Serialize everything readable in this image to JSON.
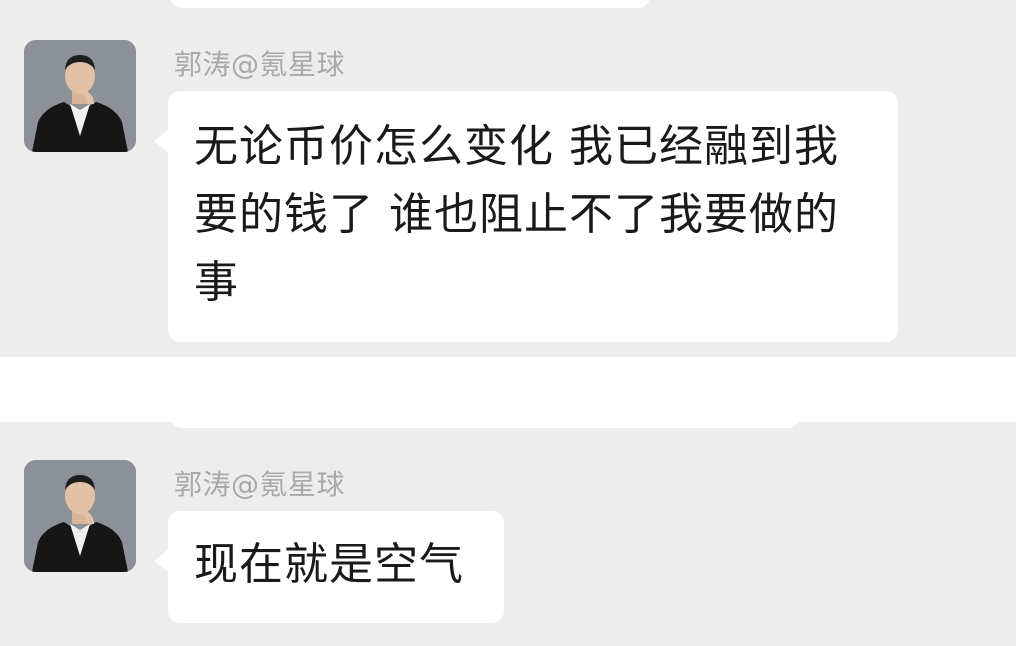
{
  "messages": [
    {
      "sender": "郭涛@氪星球",
      "avatar_icon": "user-avatar-portrait",
      "lines": [
        "无论币价怎么变化 我已经融到我",
        "要的钱了 谁也阻止不了我要做的",
        "事"
      ]
    },
    {
      "sender": "郭涛@氪星球",
      "avatar_icon": "user-avatar-portrait",
      "lines": [
        "现在就是空气"
      ]
    }
  ],
  "colors": {
    "panel_background": "#ededed",
    "bubble_background": "#ffffff",
    "sender_text": "#a9a9a9",
    "message_text": "#1a1a1a"
  }
}
